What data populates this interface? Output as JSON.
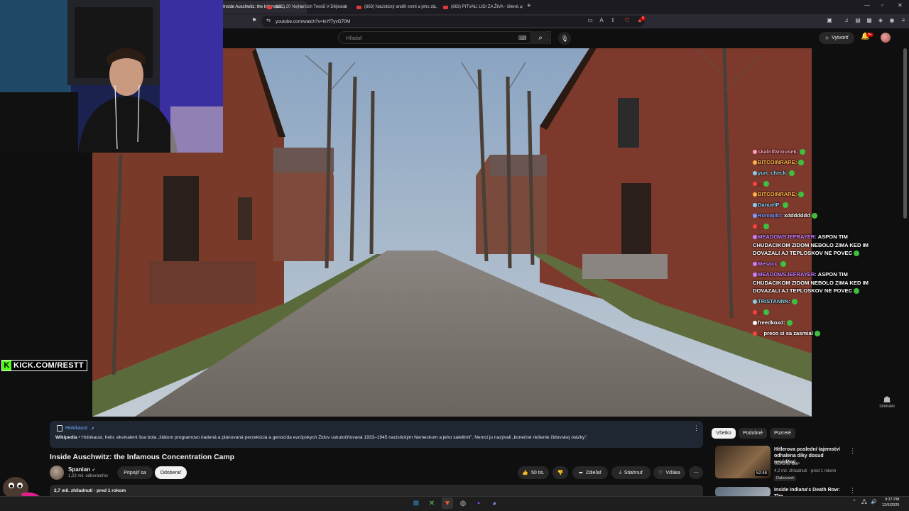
{
  "browser": {
    "tabs": [
      {
        "label": "Inside Auschwitz: the Infamous..."
      },
      {
        "label": "(663) 20 Nejhorších Trestů V Dějinách"
      },
      {
        "label": "(663) Nacistický anděl smrti a jeho zl..."
      },
      {
        "label": "(663) PITVALI LIDI ZA ŽIVA - šílené..."
      }
    ],
    "url": "youtube.com/watch?v=lxYf7yvG70M",
    "extension_badge": "9"
  },
  "youtube": {
    "search_placeholder": "Hľadať",
    "create_label": "Vytvoriť",
    "notif_count": "9+"
  },
  "stream": {
    "kick_text": "KICK.COM/RESTT",
    "kick_logo": "K",
    "watermark": "SPANIAN"
  },
  "chat": [
    {
      "user": "skalnifanousek:",
      "text": "",
      "color": "#ff9eb5"
    },
    {
      "user": "BITCOINRARE:",
      "text": "",
      "color": "#ffb347"
    },
    {
      "user": "yuri_check:",
      "text": "",
      "color": "#87ceeb"
    },
    {
      "user": "...",
      "text": "",
      "color": "#ff4040"
    },
    {
      "user": "BITCOINRARE:",
      "text": "",
      "color": "#ffb347"
    },
    {
      "user": "DanuelP:",
      "text": "",
      "color": "#87cefa"
    },
    {
      "user": "Romajdo:",
      "text": "xddddddd",
      "color": "#7f9cff"
    },
    {
      "user": "...",
      "text": "",
      "color": "#ff4040"
    },
    {
      "user": "MEADOWSJEFRAYER:",
      "text": "ASPON TIM CHUDACIKOM ZIDOM NEBOLO ZIMA KED IM DOVAZALI AJ TEPLOSKOV NE POVEC",
      "color": "#c77dff"
    },
    {
      "user": "Mesaxx:",
      "text": "",
      "color": "#c77dff"
    },
    {
      "user": "MEADOWSJEFRAYER:",
      "text": "ASPON TIM CHUDACIKOM ZIDOM NEBOLO ZIMA KED IM DOVAZALI AJ TEPLOSKOV NE POVEC",
      "color": "#c77dff"
    },
    {
      "user": "TRISTANNN:",
      "text": "",
      "color": "#87ceeb"
    },
    {
      "user": "...",
      "text": "",
      "color": "#ff4040"
    },
    {
      "user": "freedkoxd:",
      "text": "",
      "color": "#ffffff"
    },
    {
      "user": "...",
      "text": "preco si sa zasmial",
      "color": "#ff4040"
    }
  ],
  "info_panel": {
    "title": "Holokaust",
    "source": "Wikipedia",
    "text": "Holokaust, hebr. ekvivalent šoa bola „štátom programovo riadená a plánovaná perzekúcia a genocída európskych Židov uskutočňovaná 1933–1945 nacistickým Nemeckom a jeho satelitmi\". Nemci ju nazývali „konečné riešenie židovskej otázky\"."
  },
  "video": {
    "title": "Inside Auschwitz: the Infamous Concentration Camp",
    "channel": "Spanian",
    "subscribers": "1,22 mil. odberateľov",
    "join_label": "Pripojiť sa",
    "unsubscribe_label": "Odoberať",
    "likes": "50 tis.",
    "share_label": "Zdieľať",
    "download_label": "Stiahnuť",
    "thanks_label": "Vďaka",
    "meta": "2,7 mil. zhliadnutí · pred 1 rokom"
  },
  "sidebar": {
    "chips": [
      "Všetko",
      "Podobné",
      "Pozreté"
    ],
    "items": [
      {
        "title": "Hitlerova poslední tajemství odhalena díky dosud neviděný...",
        "channel": "World at War",
        "meta": "4,2 mil. zhliadnutí · pred 1 rokom",
        "badge": "Dabované",
        "duration": "52:48"
      },
      {
        "title": "Inside Indiana's Death Row: The",
        "channel": "",
        "meta": "",
        "badge": "",
        "duration": ""
      }
    ]
  },
  "taskbar": {
    "time": "9:37 PM",
    "date": "12/6/2025"
  }
}
